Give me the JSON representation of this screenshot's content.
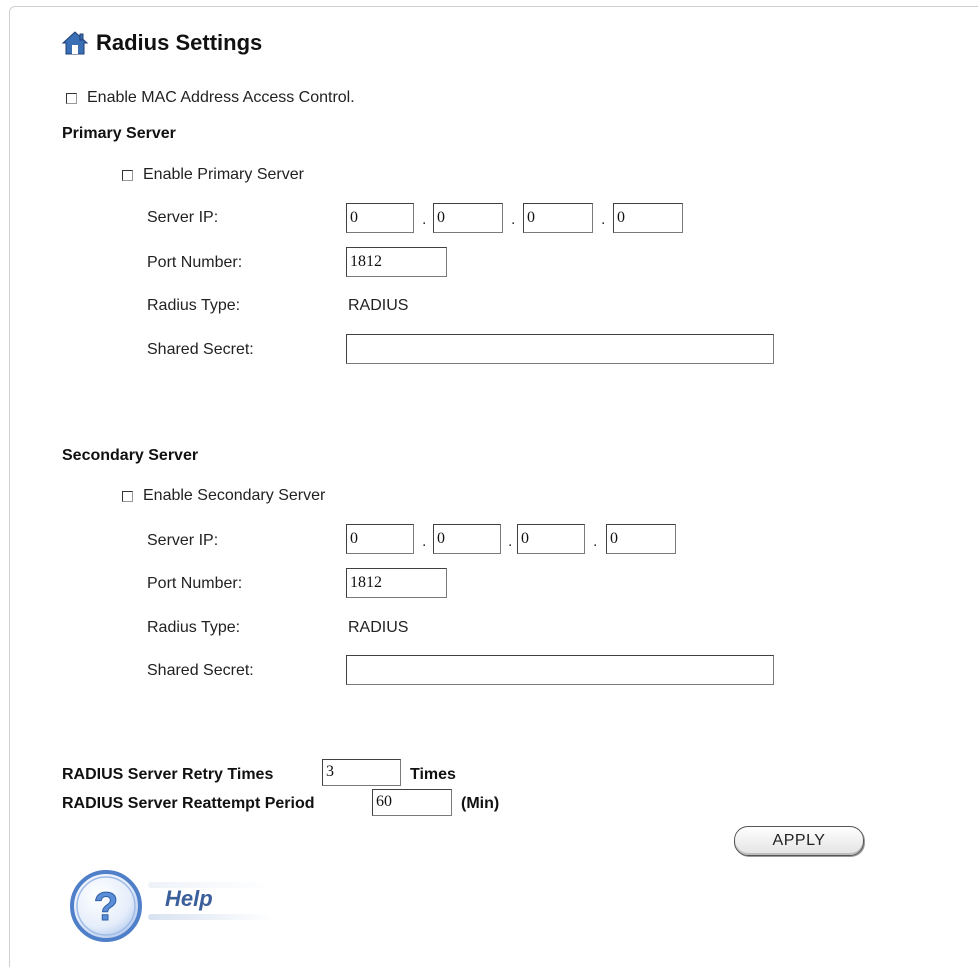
{
  "page": {
    "title": "Radius Settings",
    "mac_access_control": {
      "label": "Enable MAC Address Access Control.",
      "checked": false
    }
  },
  "primary": {
    "heading": "Primary Server",
    "enable_label": "Enable Primary Server",
    "enabled": false,
    "server_ip_label": "Server IP:",
    "ip": [
      "0",
      "0",
      "0",
      "0"
    ],
    "port_label": "Port Number:",
    "port_value": "1812",
    "radius_type_label": "Radius Type:",
    "radius_type_value": "RADIUS",
    "shared_secret_label": "Shared Secret:",
    "shared_secret_value": ""
  },
  "secondary": {
    "heading": "Secondary Server",
    "enable_label": "Enable Secondary Server",
    "enabled": false,
    "server_ip_label": "Server IP:",
    "ip": [
      "0",
      "0",
      "0",
      "0"
    ],
    "port_label": "Port Number:",
    "port_value": "1812",
    "radius_type_label": "Radius Type:",
    "radius_type_value": "RADIUS",
    "shared_secret_label": "Shared Secret:",
    "shared_secret_value": ""
  },
  "retry": {
    "label": "RADIUS Server Retry Times",
    "value": "3",
    "unit": "Times"
  },
  "reattempt": {
    "label": "RADIUS Server Reattempt Period",
    "value": "60",
    "unit": "(Min)"
  },
  "ip_separator": ".",
  "apply_label": "APPLY",
  "help_label": "Help",
  "icons": {
    "title": "home-icon",
    "help": "help-icon"
  },
  "colors": {
    "help_text": "#3b5f9a",
    "help_circle": "#5b8ed6",
    "home_icon": "#3a6fb5"
  }
}
